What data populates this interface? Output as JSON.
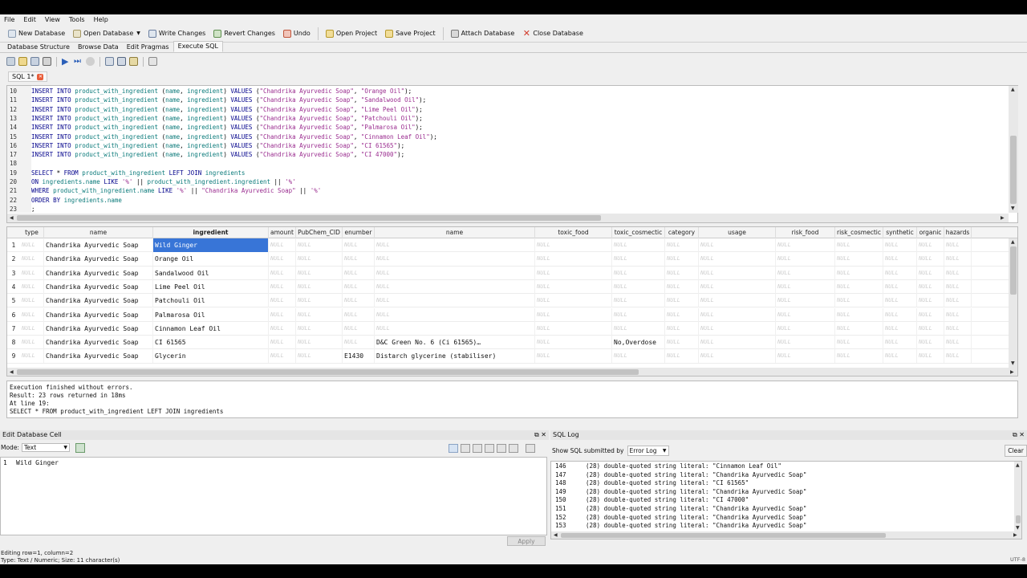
{
  "menu": [
    "File",
    "Edit",
    "View",
    "Tools",
    "Help"
  ],
  "toolbar": {
    "new_db": "New Database",
    "open_db": "Open Database",
    "write": "Write Changes",
    "revert": "Revert Changes",
    "undo": "Undo",
    "open_project": "Open Project",
    "save_project": "Save Project",
    "attach_db": "Attach Database",
    "close_db": "Close Database"
  },
  "tabs": [
    "Database Structure",
    "Browse Data",
    "Edit Pragmas",
    "Execute SQL"
  ],
  "active_tab": "Execute SQL",
  "sql_tab": {
    "label": "SQL 1*"
  },
  "editor": {
    "lines": [
      {
        "n": "10",
        "tokens": [
          [
            "kw",
            "INSERT INTO "
          ],
          [
            "tb",
            "product_with_ingredient "
          ],
          [
            "op",
            "("
          ],
          [
            "tb",
            "name"
          ],
          [
            "op",
            ", "
          ],
          [
            "tb",
            "ingredient"
          ],
          [
            "op",
            ") "
          ],
          [
            "kw",
            "VALUES "
          ],
          [
            "op",
            "("
          ],
          [
            "st",
            "\"Chandrika Ayurvedic Soap\""
          ],
          [
            "op",
            ", "
          ],
          [
            "st",
            "\"Orange Oil\""
          ],
          [
            "op",
            ");"
          ]
        ]
      },
      {
        "n": "11",
        "tokens": [
          [
            "kw",
            "INSERT INTO "
          ],
          [
            "tb",
            "product_with_ingredient "
          ],
          [
            "op",
            "("
          ],
          [
            "tb",
            "name"
          ],
          [
            "op",
            ", "
          ],
          [
            "tb",
            "ingredient"
          ],
          [
            "op",
            ") "
          ],
          [
            "kw",
            "VALUES "
          ],
          [
            "op",
            "("
          ],
          [
            "st",
            "\"Chandrika Ayurvedic Soap\""
          ],
          [
            "op",
            ", "
          ],
          [
            "st",
            "\"Sandalwood Oil\""
          ],
          [
            "op",
            ");"
          ]
        ]
      },
      {
        "n": "12",
        "tokens": [
          [
            "kw",
            "INSERT INTO "
          ],
          [
            "tb",
            "product_with_ingredient "
          ],
          [
            "op",
            "("
          ],
          [
            "tb",
            "name"
          ],
          [
            "op",
            ", "
          ],
          [
            "tb",
            "ingredient"
          ],
          [
            "op",
            ") "
          ],
          [
            "kw",
            "VALUES "
          ],
          [
            "op",
            "("
          ],
          [
            "st",
            "\"Chandrika Ayurvedic Soap\""
          ],
          [
            "op",
            ", "
          ],
          [
            "st",
            "\"Lime Peel Oil\""
          ],
          [
            "op",
            ");"
          ]
        ]
      },
      {
        "n": "13",
        "tokens": [
          [
            "kw",
            "INSERT INTO "
          ],
          [
            "tb",
            "product_with_ingredient "
          ],
          [
            "op",
            "("
          ],
          [
            "tb",
            "name"
          ],
          [
            "op",
            ", "
          ],
          [
            "tb",
            "ingredient"
          ],
          [
            "op",
            ") "
          ],
          [
            "kw",
            "VALUES "
          ],
          [
            "op",
            "("
          ],
          [
            "st",
            "\"Chandrika Ayurvedic Soap\""
          ],
          [
            "op",
            ", "
          ],
          [
            "st",
            "\"Patchouli Oil\""
          ],
          [
            "op",
            ");"
          ]
        ]
      },
      {
        "n": "14",
        "tokens": [
          [
            "kw",
            "INSERT INTO "
          ],
          [
            "tb",
            "product_with_ingredient "
          ],
          [
            "op",
            "("
          ],
          [
            "tb",
            "name"
          ],
          [
            "op",
            ", "
          ],
          [
            "tb",
            "ingredient"
          ],
          [
            "op",
            ") "
          ],
          [
            "kw",
            "VALUES "
          ],
          [
            "op",
            "("
          ],
          [
            "st",
            "\"Chandrika Ayurvedic Soap\""
          ],
          [
            "op",
            ", "
          ],
          [
            "st",
            "\"Palmarosa Oil\""
          ],
          [
            "op",
            ");"
          ]
        ]
      },
      {
        "n": "15",
        "tokens": [
          [
            "kw",
            "INSERT INTO "
          ],
          [
            "tb",
            "product_with_ingredient "
          ],
          [
            "op",
            "("
          ],
          [
            "tb",
            "name"
          ],
          [
            "op",
            ", "
          ],
          [
            "tb",
            "ingredient"
          ],
          [
            "op",
            ") "
          ],
          [
            "kw",
            "VALUES "
          ],
          [
            "op",
            "("
          ],
          [
            "st",
            "\"Chandrika Ayurvedic Soap\""
          ],
          [
            "op",
            ", "
          ],
          [
            "st",
            "\"Cinnamon Leaf Oil\""
          ],
          [
            "op",
            ");"
          ]
        ]
      },
      {
        "n": "16",
        "tokens": [
          [
            "kw",
            "INSERT INTO "
          ],
          [
            "tb",
            "product_with_ingredient "
          ],
          [
            "op",
            "("
          ],
          [
            "tb",
            "name"
          ],
          [
            "op",
            ", "
          ],
          [
            "tb",
            "ingredient"
          ],
          [
            "op",
            ") "
          ],
          [
            "kw",
            "VALUES "
          ],
          [
            "op",
            "("
          ],
          [
            "st",
            "\"Chandrika Ayurvedic Soap\""
          ],
          [
            "op",
            ", "
          ],
          [
            "st",
            "\"CI 61565\""
          ],
          [
            "op",
            ");"
          ]
        ]
      },
      {
        "n": "17",
        "tokens": [
          [
            "kw",
            "INSERT INTO "
          ],
          [
            "tb",
            "product_with_ingredient "
          ],
          [
            "op",
            "("
          ],
          [
            "tb",
            "name"
          ],
          [
            "op",
            ", "
          ],
          [
            "tb",
            "ingredient"
          ],
          [
            "op",
            ") "
          ],
          [
            "kw",
            "VALUES "
          ],
          [
            "op",
            "("
          ],
          [
            "st",
            "\"Chandrika Ayurvedic Soap\""
          ],
          [
            "op",
            ", "
          ],
          [
            "st",
            "\"CI 47000\""
          ],
          [
            "op",
            ");"
          ]
        ]
      },
      {
        "n": "18",
        "tokens": []
      },
      {
        "n": "19",
        "tokens": [
          [
            "kw",
            "SELECT "
          ],
          [
            "op",
            "* "
          ],
          [
            "kw",
            "FROM "
          ],
          [
            "tb",
            "product_with_ingredient "
          ],
          [
            "kw",
            "LEFT JOIN "
          ],
          [
            "tb",
            "ingredients"
          ]
        ]
      },
      {
        "n": "20",
        "tokens": [
          [
            "kw",
            "ON "
          ],
          [
            "tb",
            "ingredients.name "
          ],
          [
            "kw",
            "LIKE "
          ],
          [
            "st",
            "'%' "
          ],
          [
            "op",
            "|| "
          ],
          [
            "tb",
            "product_with_ingredient.ingredient "
          ],
          [
            "op",
            "|| "
          ],
          [
            "st",
            "'%'"
          ]
        ]
      },
      {
        "n": "21",
        "tokens": [
          [
            "kw",
            "WHERE "
          ],
          [
            "tb",
            "product_with_ingredient.name "
          ],
          [
            "kw",
            "LIKE "
          ],
          [
            "st",
            "'%' "
          ],
          [
            "op",
            "|| "
          ],
          [
            "st",
            "\"Chandrika Ayurvedic Soap\" "
          ],
          [
            "op",
            "|| "
          ],
          [
            "st",
            "'%'"
          ]
        ]
      },
      {
        "n": "22",
        "tokens": [
          [
            "kw",
            "ORDER BY "
          ],
          [
            "tb",
            "ingredients.name"
          ]
        ]
      },
      {
        "n": "23",
        "tokens": [
          [
            "op",
            ";"
          ]
        ]
      }
    ]
  },
  "grid": {
    "columns": [
      "type",
      "name",
      "ingredient",
      "amount",
      "PubChem_CID",
      "enumber",
      "name",
      "toxic_food",
      "toxic_cosmectic",
      "category",
      "usage",
      "risk_food",
      "risk_cosmectic",
      "synthetic",
      "organic",
      "hazards"
    ],
    "null_text": "NULL",
    "rows": [
      {
        "n": "1",
        "name": "Chandrika Ayurvedic Soap",
        "ingredient": "Wild Ginger",
        "enumber": "",
        "name2": "",
        "toxic_cosmetic": ""
      },
      {
        "n": "2",
        "name": "Chandrika Ayurvedic Soap",
        "ingredient": "Orange Oil",
        "enumber": "",
        "name2": "",
        "toxic_cosmetic": ""
      },
      {
        "n": "3",
        "name": "Chandrika Ayurvedic Soap",
        "ingredient": "Sandalwood Oil",
        "enumber": "",
        "name2": "",
        "toxic_cosmetic": ""
      },
      {
        "n": "4",
        "name": "Chandrika Ayurvedic Soap",
        "ingredient": "Lime Peel Oil",
        "enumber": "",
        "name2": "",
        "toxic_cosmetic": ""
      },
      {
        "n": "5",
        "name": "Chandrika Ayurvedic Soap",
        "ingredient": "Patchouli Oil",
        "enumber": "",
        "name2": "",
        "toxic_cosmetic": ""
      },
      {
        "n": "6",
        "name": "Chandrika Ayurvedic Soap",
        "ingredient": "Palmarosa Oil",
        "enumber": "",
        "name2": "",
        "toxic_cosmetic": ""
      },
      {
        "n": "7",
        "name": "Chandrika Ayurvedic Soap",
        "ingredient": "Cinnamon Leaf Oil",
        "enumber": "",
        "name2": "",
        "toxic_cosmetic": ""
      },
      {
        "n": "8",
        "name": "Chandrika Ayurvedic Soap",
        "ingredient": "CI 61565",
        "enumber": "",
        "name2": "D&C Green No. 6 (Ci 61565)…",
        "toxic_cosmetic": "No,Overdose"
      },
      {
        "n": "9",
        "name": "Chandrika Ayurvedic Soap",
        "ingredient": "Glycerin",
        "enumber": "E1430",
        "name2": "Distarch glycerine (stabiliser)",
        "toxic_cosmetic": ""
      }
    ]
  },
  "message": "Execution finished without errors.\nResult: 23 rows returned in 18ms\nAt line 19:\nSELECT * FROM product_with_ingredient LEFT JOIN ingredients",
  "edit_cell": {
    "title": "Edit Database Cell",
    "mode_label": "Mode:",
    "mode_value": "Text",
    "line_no": "1",
    "content": "Wild Ginger",
    "apply": "Apply",
    "status1": "Editing row=1, column=2",
    "status2": "Type: Text / Numeric; Size: 11 character(s)"
  },
  "sql_log": {
    "title": "SQL Log",
    "show_label": "Show SQL submitted by",
    "show_value": "Error Log",
    "clear": "Clear",
    "lines": [
      {
        "n": "146",
        "t": "(28) double-quoted string literal: \"Cinnamon Leaf Oil\""
      },
      {
        "n": "147",
        "t": "(28) double-quoted string literal: \"Chandrika Ayurvedic Soap\""
      },
      {
        "n": "148",
        "t": "(28) double-quoted string literal: \"CI 61565\""
      },
      {
        "n": "149",
        "t": "(28) double-quoted string literal: \"Chandrika Ayurvedic Soap\""
      },
      {
        "n": "150",
        "t": "(28) double-quoted string literal: \"CI 47000\""
      },
      {
        "n": "151",
        "t": "(28) double-quoted string literal: \"Chandrika Ayurvedic Soap\""
      },
      {
        "n": "152",
        "t": "(28) double-quoted string literal: \"Chandrika Ayurvedic Soap\""
      },
      {
        "n": "153",
        "t": "(28) double-quoted string literal: \"Chandrika Ayurvedic Soap\""
      },
      {
        "n": "154",
        "t": ""
      }
    ]
  },
  "encoding": "UTF-8",
  "colors": {
    "selection": "#3875d7",
    "close": "#e85d3a",
    "keyword": "#00008b",
    "table": "#0a7a7a",
    "string": "#9a2c8f"
  }
}
